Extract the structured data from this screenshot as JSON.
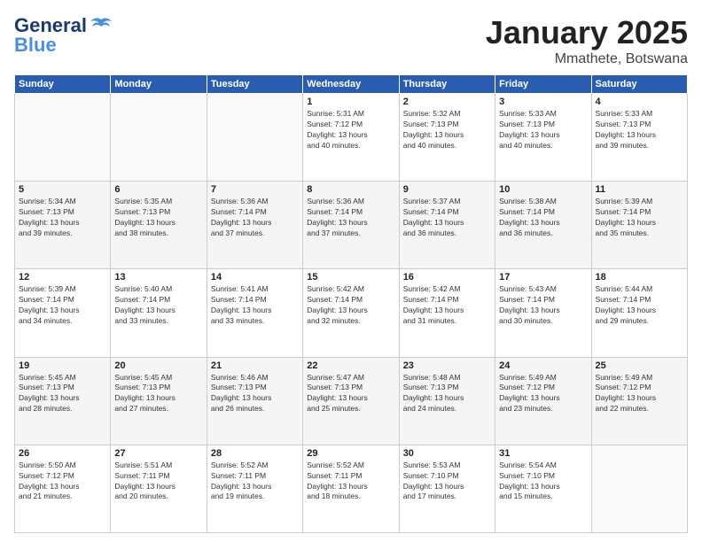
{
  "header": {
    "logo_line1": "General",
    "logo_line2": "Blue",
    "title": "January 2025",
    "location": "Mmathete, Botswana"
  },
  "days_of_week": [
    "Sunday",
    "Monday",
    "Tuesday",
    "Wednesday",
    "Thursday",
    "Friday",
    "Saturday"
  ],
  "weeks": [
    [
      {
        "day": "",
        "info": ""
      },
      {
        "day": "",
        "info": ""
      },
      {
        "day": "",
        "info": ""
      },
      {
        "day": "1",
        "info": "Sunrise: 5:31 AM\nSunset: 7:12 PM\nDaylight: 13 hours\nand 40 minutes."
      },
      {
        "day": "2",
        "info": "Sunrise: 5:32 AM\nSunset: 7:13 PM\nDaylight: 13 hours\nand 40 minutes."
      },
      {
        "day": "3",
        "info": "Sunrise: 5:33 AM\nSunset: 7:13 PM\nDaylight: 13 hours\nand 40 minutes."
      },
      {
        "day": "4",
        "info": "Sunrise: 5:33 AM\nSunset: 7:13 PM\nDaylight: 13 hours\nand 39 minutes."
      }
    ],
    [
      {
        "day": "5",
        "info": "Sunrise: 5:34 AM\nSunset: 7:13 PM\nDaylight: 13 hours\nand 39 minutes."
      },
      {
        "day": "6",
        "info": "Sunrise: 5:35 AM\nSunset: 7:13 PM\nDaylight: 13 hours\nand 38 minutes."
      },
      {
        "day": "7",
        "info": "Sunrise: 5:36 AM\nSunset: 7:14 PM\nDaylight: 13 hours\nand 37 minutes."
      },
      {
        "day": "8",
        "info": "Sunrise: 5:36 AM\nSunset: 7:14 PM\nDaylight: 13 hours\nand 37 minutes."
      },
      {
        "day": "9",
        "info": "Sunrise: 5:37 AM\nSunset: 7:14 PM\nDaylight: 13 hours\nand 36 minutes."
      },
      {
        "day": "10",
        "info": "Sunrise: 5:38 AM\nSunset: 7:14 PM\nDaylight: 13 hours\nand 36 minutes."
      },
      {
        "day": "11",
        "info": "Sunrise: 5:39 AM\nSunset: 7:14 PM\nDaylight: 13 hours\nand 35 minutes."
      }
    ],
    [
      {
        "day": "12",
        "info": "Sunrise: 5:39 AM\nSunset: 7:14 PM\nDaylight: 13 hours\nand 34 minutes."
      },
      {
        "day": "13",
        "info": "Sunrise: 5:40 AM\nSunset: 7:14 PM\nDaylight: 13 hours\nand 33 minutes."
      },
      {
        "day": "14",
        "info": "Sunrise: 5:41 AM\nSunset: 7:14 PM\nDaylight: 13 hours\nand 33 minutes."
      },
      {
        "day": "15",
        "info": "Sunrise: 5:42 AM\nSunset: 7:14 PM\nDaylight: 13 hours\nand 32 minutes."
      },
      {
        "day": "16",
        "info": "Sunrise: 5:42 AM\nSunset: 7:14 PM\nDaylight: 13 hours\nand 31 minutes."
      },
      {
        "day": "17",
        "info": "Sunrise: 5:43 AM\nSunset: 7:14 PM\nDaylight: 13 hours\nand 30 minutes."
      },
      {
        "day": "18",
        "info": "Sunrise: 5:44 AM\nSunset: 7:14 PM\nDaylight: 13 hours\nand 29 minutes."
      }
    ],
    [
      {
        "day": "19",
        "info": "Sunrise: 5:45 AM\nSunset: 7:13 PM\nDaylight: 13 hours\nand 28 minutes."
      },
      {
        "day": "20",
        "info": "Sunrise: 5:45 AM\nSunset: 7:13 PM\nDaylight: 13 hours\nand 27 minutes."
      },
      {
        "day": "21",
        "info": "Sunrise: 5:46 AM\nSunset: 7:13 PM\nDaylight: 13 hours\nand 26 minutes."
      },
      {
        "day": "22",
        "info": "Sunrise: 5:47 AM\nSunset: 7:13 PM\nDaylight: 13 hours\nand 25 minutes."
      },
      {
        "day": "23",
        "info": "Sunrise: 5:48 AM\nSunset: 7:13 PM\nDaylight: 13 hours\nand 24 minutes."
      },
      {
        "day": "24",
        "info": "Sunrise: 5:49 AM\nSunset: 7:12 PM\nDaylight: 13 hours\nand 23 minutes."
      },
      {
        "day": "25",
        "info": "Sunrise: 5:49 AM\nSunset: 7:12 PM\nDaylight: 13 hours\nand 22 minutes."
      }
    ],
    [
      {
        "day": "26",
        "info": "Sunrise: 5:50 AM\nSunset: 7:12 PM\nDaylight: 13 hours\nand 21 minutes."
      },
      {
        "day": "27",
        "info": "Sunrise: 5:51 AM\nSunset: 7:11 PM\nDaylight: 13 hours\nand 20 minutes."
      },
      {
        "day": "28",
        "info": "Sunrise: 5:52 AM\nSunset: 7:11 PM\nDaylight: 13 hours\nand 19 minutes."
      },
      {
        "day": "29",
        "info": "Sunrise: 5:52 AM\nSunset: 7:11 PM\nDaylight: 13 hours\nand 18 minutes."
      },
      {
        "day": "30",
        "info": "Sunrise: 5:53 AM\nSunset: 7:10 PM\nDaylight: 13 hours\nand 17 minutes."
      },
      {
        "day": "31",
        "info": "Sunrise: 5:54 AM\nSunset: 7:10 PM\nDaylight: 13 hours\nand 15 minutes."
      },
      {
        "day": "",
        "info": ""
      }
    ]
  ]
}
